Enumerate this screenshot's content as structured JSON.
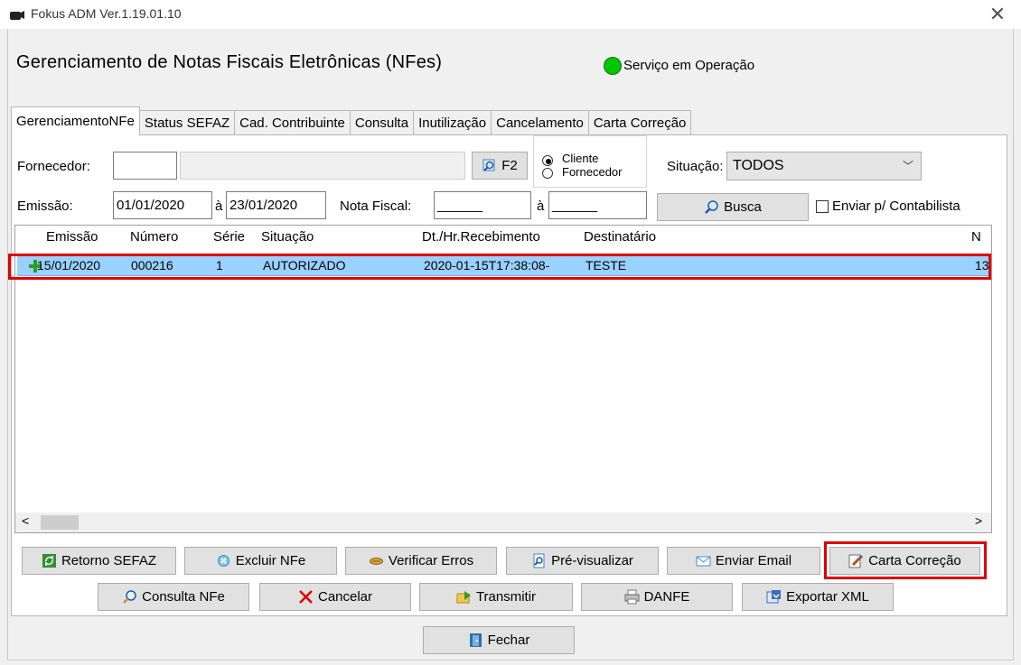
{
  "window": {
    "title": "Fokus ADM Ver.1.19.01.10",
    "close": "✕"
  },
  "header": {
    "title": "Gerenciamento de Notas Fiscais Eletrônicas (NFes)",
    "status": "Serviço em Operação",
    "status_color": "#00c800"
  },
  "tabs": [
    {
      "label": "GerenciamentoNFe",
      "active": true
    },
    {
      "label": "Status SEFAZ"
    },
    {
      "label": "Cad. Contribuinte"
    },
    {
      "label": "Consulta"
    },
    {
      "label": "Inutilização"
    },
    {
      "label": "Cancelamento"
    },
    {
      "label": "Carta Correção"
    }
  ],
  "filters": {
    "fornecedor_label": "Fornecedor:",
    "fornecedor_code": "",
    "fornecedor_name": "",
    "f2_label": "F2",
    "radio_cliente": "Cliente",
    "radio_fornecedor": "Fornecedor",
    "situacao_label": "Situação:",
    "situacao_value": "TODOS",
    "emissao_label": "Emissão:",
    "emissao_from": "01/01/2020",
    "a_label": "à",
    "emissao_to": "23/01/2020",
    "nota_label": "Nota Fiscal:",
    "nota_from": "______",
    "nota_a_label": "à",
    "nota_to": "______",
    "busca_label": "Busca",
    "enviar_contab_label": "Enviar p/ Contabilista"
  },
  "grid": {
    "columns": [
      "Emissão",
      "Número",
      "Série",
      "Situação",
      "Dt./Hr.Recebimento",
      "Destinatário",
      "N"
    ],
    "rows": [
      {
        "emissao": "15/01/2020",
        "numero": "000216",
        "serie": "1",
        "situacao": "AUTORIZADO",
        "recebimento": "2020-01-15T17:38:08-",
        "destinatario": "TESTE",
        "extra": "13"
      }
    ],
    "scroll_left": "<",
    "scroll_right": ">"
  },
  "actions": {
    "row1": [
      "Retorno SEFAZ",
      "Excluir NFe",
      "Verificar Erros",
      "Pré-visualizar",
      "Enviar Email",
      "Carta Correção"
    ],
    "row2": [
      "Consulta NFe",
      "Cancelar",
      "Transmitir",
      "DANFE",
      "Exportar XML"
    ],
    "fechar": "Fechar"
  }
}
